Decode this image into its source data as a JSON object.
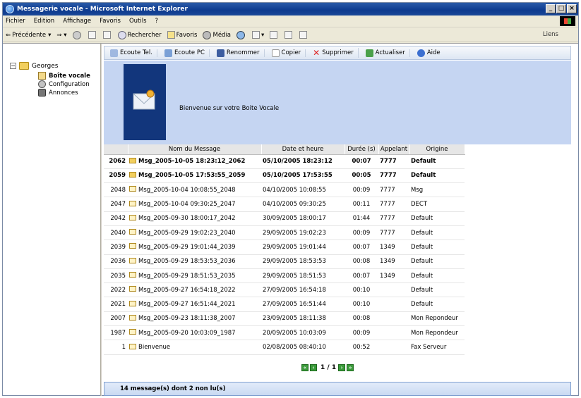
{
  "window": {
    "title": "Messagerie vocale - Microsoft Internet Explorer"
  },
  "menu": {
    "items": [
      "Fichier",
      "Edition",
      "Affichage",
      "Favoris",
      "Outils",
      "?"
    ]
  },
  "ie_toolbar": {
    "back": "Précédente",
    "search": "Rechercher",
    "favorites": "Favoris",
    "media": "Média",
    "links": "Liens"
  },
  "tree": {
    "root": "Georges",
    "items": [
      "Boîte vocale",
      "Configuration",
      "Annonces"
    ]
  },
  "app_toolbar": {
    "buttons": [
      "Ecoute Tel.",
      "Ecoute PC",
      "Renommer",
      "Copier",
      "Supprimer",
      "Actualiser",
      "Aide"
    ]
  },
  "banner": {
    "welcome": "Bienvenue sur votre Boite Vocale"
  },
  "table": {
    "headers": [
      "Nom du Message",
      "Date et heure",
      "Durée (s)",
      "Appelant",
      "Origine"
    ],
    "rows": [
      {
        "id": "2062",
        "name": "Msg_2005-10-05 18:23:12_2062",
        "date": "05/10/2005 18:23:12",
        "duration": "00:07",
        "caller": "7777",
        "origin": "Default",
        "unread": true
      },
      {
        "id": "2059",
        "name": "Msg_2005-10-05 17:53:55_2059",
        "date": "05/10/2005 17:53:55",
        "duration": "00:05",
        "caller": "7777",
        "origin": "Default",
        "unread": true
      },
      {
        "id": "2048",
        "name": "Msg_2005-10-04 10:08:55_2048",
        "date": "04/10/2005 10:08:55",
        "duration": "00:09",
        "caller": "7777",
        "origin": "Msg",
        "unread": false
      },
      {
        "id": "2047",
        "name": "Msg_2005-10-04 09:30:25_2047",
        "date": "04/10/2005 09:30:25",
        "duration": "00:11",
        "caller": "7777",
        "origin": "DECT",
        "unread": false
      },
      {
        "id": "2042",
        "name": "Msg_2005-09-30 18:00:17_2042",
        "date": "30/09/2005 18:00:17",
        "duration": "01:44",
        "caller": "7777",
        "origin": "Default",
        "unread": false
      },
      {
        "id": "2040",
        "name": "Msg_2005-09-29 19:02:23_2040",
        "date": "29/09/2005 19:02:23",
        "duration": "00:09",
        "caller": "7777",
        "origin": "Default",
        "unread": false
      },
      {
        "id": "2039",
        "name": "Msg_2005-09-29 19:01:44_2039",
        "date": "29/09/2005 19:01:44",
        "duration": "00:07",
        "caller": "1349",
        "origin": "Default",
        "unread": false
      },
      {
        "id": "2036",
        "name": "Msg_2005-09-29 18:53:53_2036",
        "date": "29/09/2005 18:53:53",
        "duration": "00:08",
        "caller": "1349",
        "origin": "Default",
        "unread": false
      },
      {
        "id": "2035",
        "name": "Msg_2005-09-29 18:51:53_2035",
        "date": "29/09/2005 18:51:53",
        "duration": "00:07",
        "caller": "1349",
        "origin": "Default",
        "unread": false
      },
      {
        "id": "2022",
        "name": "Msg_2005-09-27 16:54:18_2022",
        "date": "27/09/2005 16:54:18",
        "duration": "00:10",
        "caller": "",
        "origin": "Default",
        "unread": false
      },
      {
        "id": "2021",
        "name": "Msg_2005-09-27 16:51:44_2021",
        "date": "27/09/2005 16:51:44",
        "duration": "00:10",
        "caller": "",
        "origin": "Default",
        "unread": false
      },
      {
        "id": "2007",
        "name": "Msg_2005-09-23 18:11:38_2007",
        "date": "23/09/2005 18:11:38",
        "duration": "00:08",
        "caller": "",
        "origin": "Mon Repondeur",
        "unread": false
      },
      {
        "id": "1987",
        "name": "Msg_2005-09-20 10:03:09_1987",
        "date": "20/09/2005 10:03:09",
        "duration": "00:09",
        "caller": "",
        "origin": "Mon Repondeur",
        "unread": false
      },
      {
        "id": "1",
        "name": "Bienvenue",
        "date": "02/08/2005 08:40:10",
        "duration": "00:52",
        "caller": "",
        "origin": "Fax Serveur",
        "unread": false
      }
    ]
  },
  "pager": {
    "text": "1 / 1"
  },
  "status": {
    "text": "14 message(s) dont 2 non lu(s)"
  }
}
